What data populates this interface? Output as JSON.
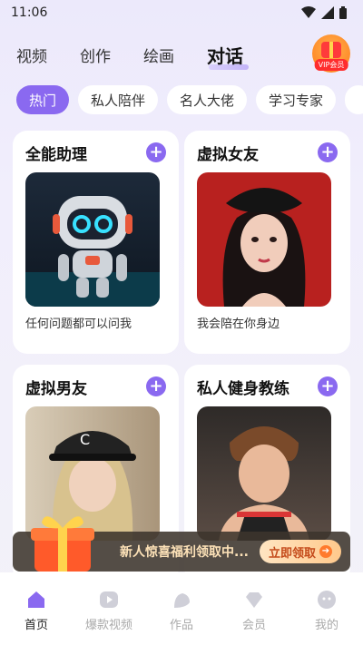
{
  "status": {
    "time": "11:06"
  },
  "top_tabs": [
    "视频",
    "创作",
    "绘画",
    "对话"
  ],
  "vip": {
    "label": "VIP会员"
  },
  "chips": [
    "热门",
    "私人陪伴",
    "名人大佬",
    "学习专家"
  ],
  "cards": [
    {
      "title": "全能助理",
      "subtitle": "任何问题都可以问我"
    },
    {
      "title": "虚拟女友",
      "subtitle": "我会陪在你身边"
    },
    {
      "title": "虚拟男友",
      "subtitle": ""
    },
    {
      "title": "私人健身教练",
      "subtitle": ""
    }
  ],
  "promo": {
    "text": "新人惊喜福利领取中...",
    "button": "立即领取"
  },
  "nav": [
    "首页",
    "爆款视频",
    "作品",
    "会员",
    "我的"
  ],
  "colors": {
    "accent": "#8a69f0",
    "promo_bg": "#3c342c"
  }
}
